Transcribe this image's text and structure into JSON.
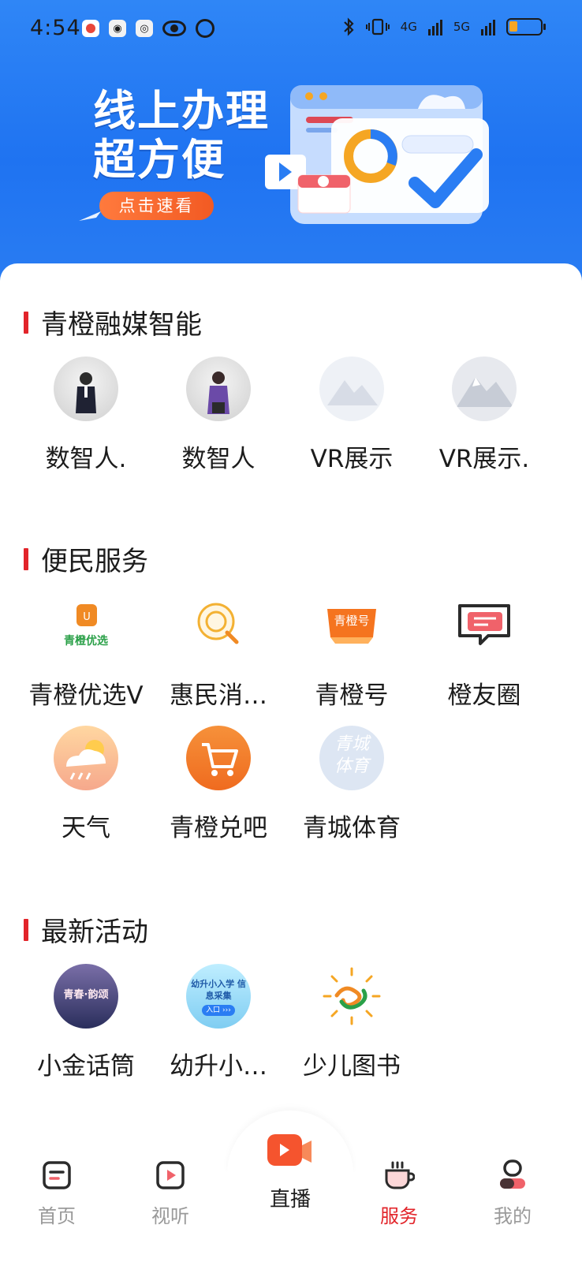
{
  "status_bar": {
    "time": "4:54",
    "network_4g": "4G",
    "network_5g": "5G"
  },
  "banner": {
    "headline_line1": "线上办理",
    "headline_line2": "超方便",
    "cta": "点击速看",
    "accent_color": "#1f73f1"
  },
  "sections": {
    "smart_media": {
      "title": "青橙融媒智能",
      "items": [
        {
          "label": "数智人.",
          "icon": "digital-human-male-icon"
        },
        {
          "label": "数智人",
          "icon": "digital-human-female-icon"
        },
        {
          "label": "VR展示",
          "icon": "vr-mountain-icon"
        },
        {
          "label": "VR展示.",
          "icon": "vr-snow-mountain-icon"
        }
      ]
    },
    "services": {
      "title": "便民服务",
      "items": [
        {
          "label": "青橙优选V",
          "icon": "qingcheng-select-icon",
          "icon_text": "青橙优选"
        },
        {
          "label": "惠民消…",
          "icon": "consumer-search-icon"
        },
        {
          "label": "青橙号",
          "icon": "qingcheng-hao-icon",
          "icon_text": "青橙号"
        },
        {
          "label": "橙友圈",
          "icon": "chat-bubble-icon"
        },
        {
          "label": "天气",
          "icon": "weather-icon"
        },
        {
          "label": "青橙兑吧",
          "icon": "shopping-cart-icon"
        },
        {
          "label": "青城体育",
          "icon": "sports-icon",
          "icon_text": "青城体育"
        }
      ]
    },
    "activities": {
      "title": "最新活动",
      "items": [
        {
          "label": "小金话筒",
          "icon": "microphone-event-icon",
          "icon_text": "青春·韵颂"
        },
        {
          "label": "幼升小…",
          "icon": "school-enroll-icon",
          "icon_text": "幼升小入学 信息采集",
          "icon_badge": "入口 ›››"
        },
        {
          "label": "少儿图书",
          "icon": "kids-book-sun-icon"
        }
      ]
    }
  },
  "tabbar": {
    "tabs": [
      {
        "label": "首页",
        "icon": "home-icon"
      },
      {
        "label": "视听",
        "icon": "video-play-icon"
      },
      {
        "label": "直播",
        "icon": "live-camera-icon"
      },
      {
        "label": "服务",
        "icon": "service-cup-icon"
      },
      {
        "label": "我的",
        "icon": "profile-icon"
      }
    ],
    "active_color": "#e2242a",
    "inactive_color": "#9a9a9a"
  }
}
